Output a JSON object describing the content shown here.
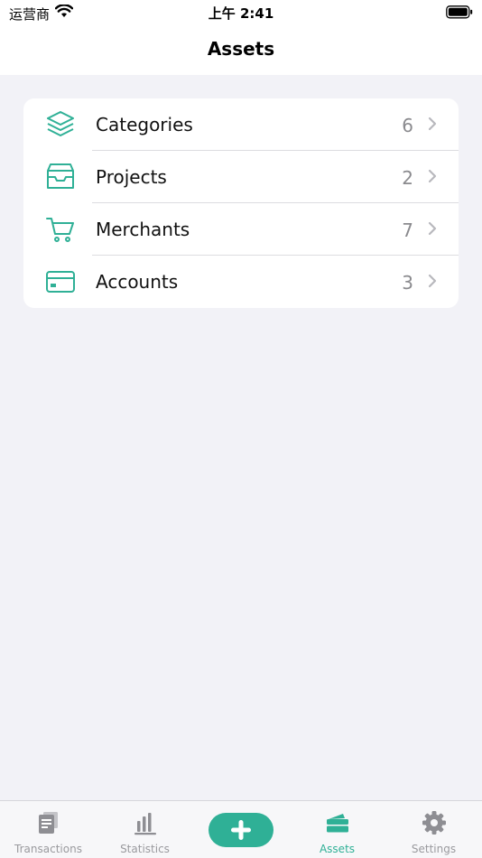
{
  "status_bar": {
    "carrier": "运营商",
    "time": "上午 2:41"
  },
  "nav": {
    "title": "Assets"
  },
  "list": {
    "items": [
      {
        "label": "Categories",
        "count": "6",
        "icon": "layers-icon"
      },
      {
        "label": "Projects",
        "count": "2",
        "icon": "inbox-tray-icon"
      },
      {
        "label": "Merchants",
        "count": "7",
        "icon": "shopping-cart-icon"
      },
      {
        "label": "Accounts",
        "count": "3",
        "icon": "credit-card-icon"
      }
    ]
  },
  "tab_bar": {
    "tabs": [
      {
        "label": "Transactions",
        "icon": "document-icon",
        "active": false
      },
      {
        "label": "Statistics",
        "icon": "bar-chart-icon",
        "active": false
      },
      {
        "label": "",
        "icon": "plus-icon",
        "active": false
      },
      {
        "label": "Assets",
        "icon": "wallet-icon",
        "active": true
      },
      {
        "label": "Settings",
        "icon": "gear-icon",
        "active": false
      }
    ]
  },
  "colors": {
    "accent": "#2fb096",
    "background": "#f2f2f7",
    "inactive": "#9a9a9e"
  }
}
